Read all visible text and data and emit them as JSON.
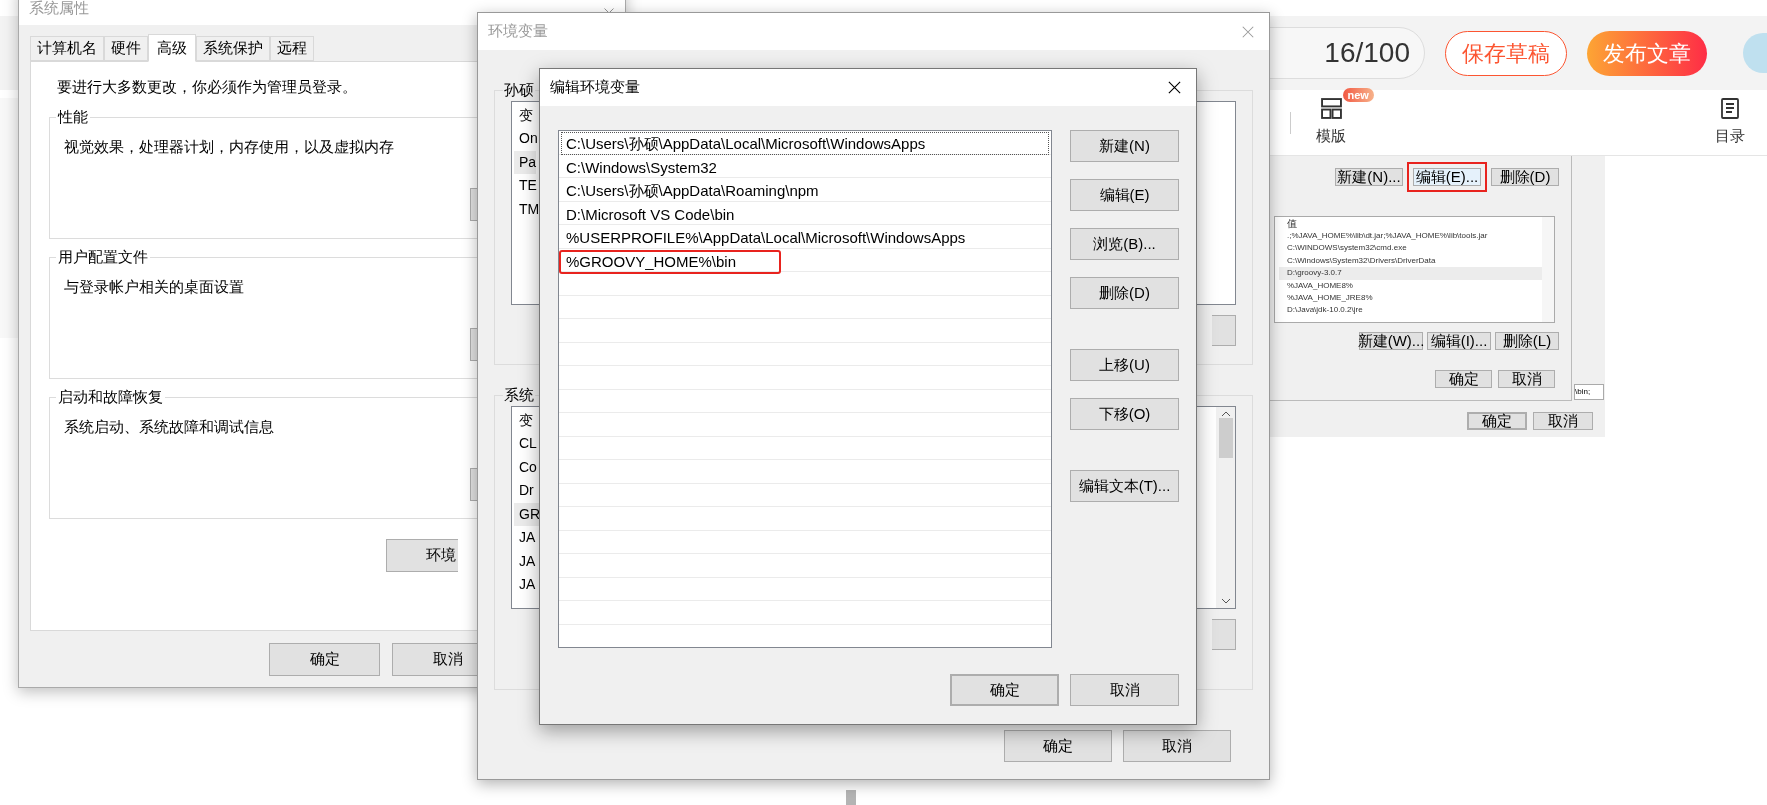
{
  "blog_editor": {
    "word_count": "16/100",
    "save_draft": "保存草稿",
    "publish": "发布文章",
    "toolbar": [
      {
        "kind": "template",
        "label": "模版",
        "badge": "new"
      },
      {
        "kind": "outline",
        "label": "目录"
      }
    ],
    "embedded_screenshot": {
      "top_buttons": [
        {
          "label": "新建(N)...",
          "annotated": false
        },
        {
          "label": "编辑(E)...",
          "annotated": true
        },
        {
          "label": "删除(D)",
          "annotated": false
        }
      ],
      "list_header": "值",
      "values": [
        {
          "text": ".;%JAVA_HOME%\\lib\\dt.jar;%JAVA_HOME%\\lib\\tools.jar",
          "selected": false
        },
        {
          "text": "C:\\WINDOWS\\system32\\cmd.exe",
          "selected": false
        },
        {
          "text": "C:\\Windows\\System32\\Drivers\\DriverData",
          "selected": false
        },
        {
          "text": "D:\\groovy-3.0.7",
          "selected": true
        },
        {
          "text": "%JAVA_HOME8%",
          "selected": false
        },
        {
          "text": "%JAVA_HOME_JRE8%",
          "selected": false
        },
        {
          "text": "D:\\Java\\jdk-10.0.2\\jre",
          "selected": false
        }
      ],
      "bottom_buttons": [
        "新建(W)...",
        "编辑(I)...",
        "删除(L)"
      ],
      "dialog_buttons": [
        "确定",
        "取消"
      ],
      "back_value": "\\bin;",
      "back_buttons": [
        {
          "label": "确定",
          "default": true
        },
        {
          "label": "取消",
          "default": false
        }
      ]
    }
  },
  "system_properties": {
    "title": "系统属性",
    "tabs": [
      {
        "label": "计算机名",
        "selected": false
      },
      {
        "label": "硬件",
        "selected": false
      },
      {
        "label": "高级",
        "selected": true
      },
      {
        "label": "系统保护",
        "selected": false
      },
      {
        "label": "远程",
        "selected": false
      }
    ],
    "admin_note": "要进行大多数更改，你必须作为管理员登录。",
    "groups": [
      {
        "title": "性能",
        "description": "视觉效果，处理器计划，内存使用，以及虚拟内存"
      },
      {
        "title": "用户配置文件",
        "description": "与登录帐户相关的桌面设置"
      },
      {
        "title": "启动和故障恢复",
        "description": "系统启动、系统故障和调试信息"
      }
    ],
    "env_button": "环境",
    "buttons": [
      "确定",
      "取消"
    ]
  },
  "env_vars": {
    "title": "环境变量",
    "user_group": "孙硕",
    "user_list": {
      "header": "变",
      "rows": [
        {
          "text": "On",
          "selected": false
        },
        {
          "text": "Pa",
          "selected": true
        },
        {
          "text": "TE",
          "selected": false
        },
        {
          "text": "TM",
          "selected": false
        }
      ]
    },
    "system_group": "系统",
    "system_list": {
      "header": "变",
      "rows": [
        {
          "text": "CL",
          "selected": false
        },
        {
          "text": "Co",
          "selected": false
        },
        {
          "text": "Dr",
          "selected": false
        },
        {
          "text": "GR",
          "selected": true
        },
        {
          "text": "JA",
          "selected": false
        },
        {
          "text": "JA",
          "selected": false
        },
        {
          "text": "JA",
          "selected": false
        }
      ]
    },
    "buttons": [
      "确定",
      "取消"
    ]
  },
  "edit_env": {
    "title": "编辑环境变量",
    "entries": [
      {
        "text": "C:\\Users\\孙硕\\AppData\\Local\\Microsoft\\WindowsApps",
        "focused": true,
        "annotated": false
      },
      {
        "text": "C:\\Windows\\System32",
        "focused": false,
        "annotated": false
      },
      {
        "text": "C:\\Users\\孙硕\\AppData\\Roaming\\npm",
        "focused": false,
        "annotated": false
      },
      {
        "text": "D:\\Microsoft VS Code\\bin",
        "focused": false,
        "annotated": false
      },
      {
        "text": "%USERPROFILE%\\AppData\\Local\\Microsoft\\WindowsApps",
        "focused": false,
        "annotated": false
      },
      {
        "text": "%GROOVY_HOME%\\bin",
        "focused": false,
        "annotated": true
      }
    ],
    "button_groups": [
      [
        "新建(N)",
        "编辑(E)",
        "浏览(B)...",
        "删除(D)"
      ],
      [
        "上移(U)",
        "下移(O)"
      ],
      [
        "编辑文本(T)..."
      ]
    ],
    "ok": "确定",
    "cancel": "取消"
  }
}
